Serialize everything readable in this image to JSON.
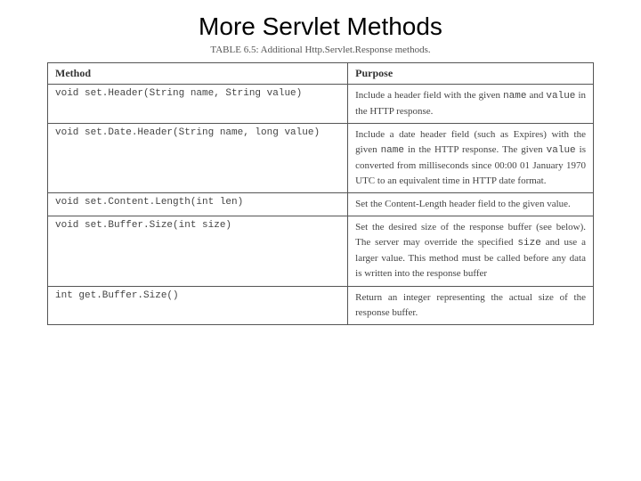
{
  "title": "More Servlet Methods",
  "caption": "TABLE 6.5: Additional Http.Servlet.Response methods.",
  "columns": {
    "method": "Method",
    "purpose": "Purpose"
  },
  "rows": [
    {
      "method": "void set.Header(String name, String value)",
      "purpose": "Include a header field with the given <code>name</code> and <code>value</code> in the HTTP response."
    },
    {
      "method": "void set.Date.Header(String name, long value)",
      "purpose": "Include a date header field (such as Expires) with the given <code>name</code> in the HTTP response. The given <code>value</code> is converted from milliseconds since 00:00 01 January 1970 UTC to an equivalent time in HTTP date format."
    },
    {
      "method": "void set.Content.Length(int len)",
      "purpose": "Set the Content-Length header field to the given value."
    },
    {
      "method": "void set.Buffer.Size(int size)",
      "purpose": "Set the desired size of the response buffer (see below). The server may override the specified <code>size</code> and use a larger value. This method must be called before any data is written into the response buffer"
    },
    {
      "method": "int get.Buffer.Size()",
      "purpose": "Return an integer representing the actual size of the response buffer."
    }
  ]
}
